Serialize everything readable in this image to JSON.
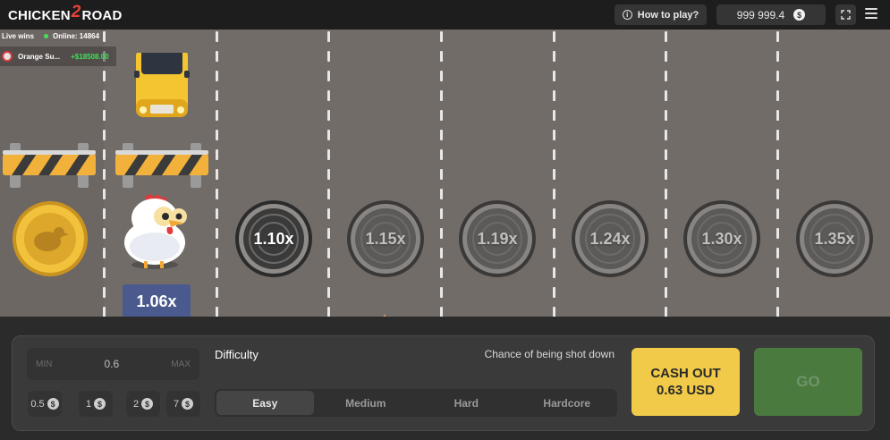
{
  "header": {
    "logo_left": "CHICKEN",
    "logo_num": "2",
    "logo_right": "ROAD",
    "how_to_play": "How to play?",
    "info_icon": "i",
    "balance": "999 999.4",
    "currency_symbol": "$"
  },
  "live": {
    "live_wins_label": "Live wins",
    "online_label": "Online: 14864",
    "latest_win": {
      "player": "Orange Su...",
      "amount": "+$18508.00"
    }
  },
  "road": {
    "current_multiplier": "1.06x",
    "lanes": [
      {
        "multiplier": "1.10x",
        "state": "next"
      },
      {
        "multiplier": "1.15x",
        "state": "locked"
      },
      {
        "multiplier": "1.19x",
        "state": "locked"
      },
      {
        "multiplier": "1.24x",
        "state": "locked"
      },
      {
        "multiplier": "1.30x",
        "state": "locked"
      },
      {
        "multiplier": "1.35x",
        "state": "locked"
      }
    ]
  },
  "controls": {
    "min_label": "MIN",
    "max_label": "MAX",
    "bet_value": "0.6",
    "quick_bets": [
      "0.5",
      "1",
      "2",
      "7"
    ],
    "difficulty_label": "Difficulty",
    "chance_label": "Chance of being shot down",
    "difficulties": [
      "Easy",
      "Medium",
      "Hard",
      "Hardcore"
    ],
    "selected_difficulty": "Easy",
    "cashout_line1": "CASH OUT",
    "cashout_line2": "0.63 USD",
    "go_label": "GO"
  },
  "colors": {
    "road": "#726c69",
    "cashout": "#f0ca48",
    "go": "#4b7a3f",
    "multiplier_tag": "#4a5a8e",
    "win_amount": "#3ee05a"
  }
}
